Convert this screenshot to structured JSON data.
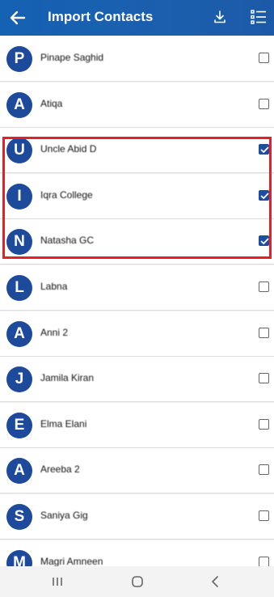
{
  "header": {
    "title": "Import Contacts",
    "icons": [
      "arrow-left-icon",
      "download-icon",
      "checklist-icon"
    ]
  },
  "contacts": [
    {
      "initial": "P",
      "name": "Pinape Saghid",
      "checked": false
    },
    {
      "initial": "A",
      "name": "Atiqa",
      "checked": false
    },
    {
      "initial": "U",
      "name": "Uncle Abid D",
      "checked": true
    },
    {
      "initial": "I",
      "name": "Iqra College",
      "checked": true
    },
    {
      "initial": "N",
      "name": "Natasha GC",
      "checked": true
    },
    {
      "initial": "L",
      "name": "Labna",
      "checked": false
    },
    {
      "initial": "A",
      "name": "Anni 2",
      "checked": false
    },
    {
      "initial": "J",
      "name": "Jamila Kiran",
      "checked": false
    },
    {
      "initial": "E",
      "name": "Elma Elani",
      "checked": false
    },
    {
      "initial": "A",
      "name": "Areeba 2",
      "checked": false
    },
    {
      "initial": "S",
      "name": "Saniya Gig",
      "checked": false
    },
    {
      "initial": "M",
      "name": "Magri Amneen",
      "checked": false
    }
  ],
  "colors": {
    "header": "#1b5fae",
    "avatar": "#1e4a9c",
    "checkbox_checked": "#1c4ea0",
    "highlight": "#e41f26"
  },
  "navbar": {
    "icons": [
      "recent-apps-icon",
      "home-icon",
      "back-icon"
    ]
  }
}
